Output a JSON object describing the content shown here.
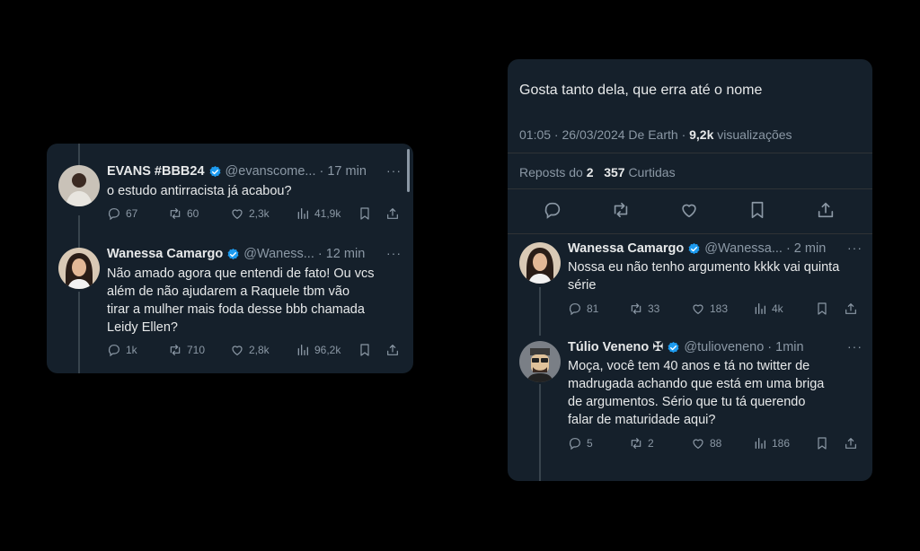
{
  "left_card": {
    "tweets": [
      {
        "name": "EVANS #BBB24",
        "handle": "@evanscome...",
        "time": "· 17 min",
        "text": "o estudo antirracista já acabou?",
        "replies": "67",
        "reposts": "60",
        "likes": "2,3k",
        "views": "41,9k"
      },
      {
        "name": "Wanessa Camargo",
        "handle": "@Waness...",
        "time": "· 12 min",
        "text_lines": [
          "Não amado agora que entendi de fato! Ou vcs",
          "além de não ajudarem a Raquele tbm vão",
          "tirar a mulher mais foda desse bbb chamada",
          "Leidy Ellen?"
        ],
        "replies": "1k",
        "reposts": "710",
        "likes": "2,8k",
        "views": "96,2k"
      }
    ]
  },
  "right_card": {
    "main_text": "Gosta tanto dela, que erra até o nome",
    "meta": {
      "time_date": "01:05 · 26/03/2024 De Earth ·",
      "views": "9,2k",
      "views_label": "visualizações"
    },
    "stats": {
      "reposts_label": "Reposts do",
      "reposts": "2",
      "likes": "357",
      "likes_label": "Curtidas"
    },
    "replies": [
      {
        "name": "Wanessa Camargo",
        "handle": "@Wanessa...",
        "time": "· 2 min",
        "text_lines": [
          "Nossa eu não tenho argumento kkkk vai quinta",
          "série"
        ],
        "replies": "81",
        "reposts": "33",
        "likes": "183",
        "views": "4k"
      },
      {
        "name": "Túlio Veneno",
        "badge": "✠",
        "handle": "@tulioveneno",
        "time": "· 1min",
        "text_lines": [
          "Moça, você tem 40 anos e tá no twitter de",
          "madrugada achando que está em uma briga",
          "de argumentos. Sério que tu tá querendo",
          "falar de maturidade aqui?"
        ],
        "replies": "5",
        "reposts": "2",
        "likes": "88",
        "views": "186"
      }
    ]
  },
  "colors": {
    "card_bg": "#15202b",
    "muted": "#8b98a5",
    "verified": "#1d9bf0"
  }
}
